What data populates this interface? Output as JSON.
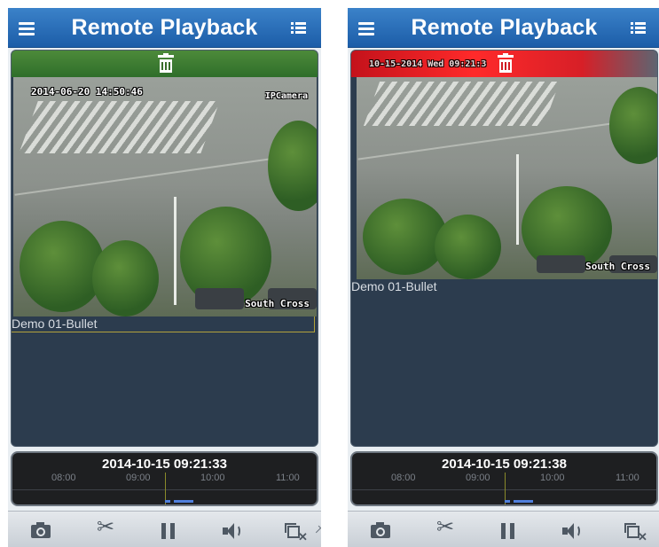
{
  "screens": [
    {
      "title": "Remote Playback",
      "osd_time": "2014-06-20 14:50:46",
      "osd_camera_name": "IPCamera",
      "osd_location": "South Cross",
      "camera_label": "Demo 01-Bullet",
      "delete_zone_state": "idle",
      "timeline": {
        "datetime": "2014-10-15 09:21:33",
        "ticks": [
          "08:00",
          "09:00",
          "10:00",
          "11:00"
        ]
      }
    },
    {
      "title": "Remote Playback",
      "osd_time": "10-15-2014 Wed 09:21:3",
      "osd_location": "South Cross",
      "camera_label": "Demo 01-Bullet",
      "delete_zone_state": "armed",
      "timeline": {
        "datetime": "2014-10-15 09:21:38",
        "ticks": [
          "08:00",
          "09:00",
          "10:00",
          "11:00"
        ]
      }
    }
  ],
  "toolbar": {
    "buttons": [
      "camera-icon",
      "scissors-icon",
      "pause-icon",
      "speaker-icon",
      "close-window-icon"
    ]
  },
  "colors": {
    "header": "#1c5da8",
    "delete_idle": "#2f6e2a",
    "delete_armed": "#ff2a2a",
    "record_segment": "#4f7fdc"
  }
}
